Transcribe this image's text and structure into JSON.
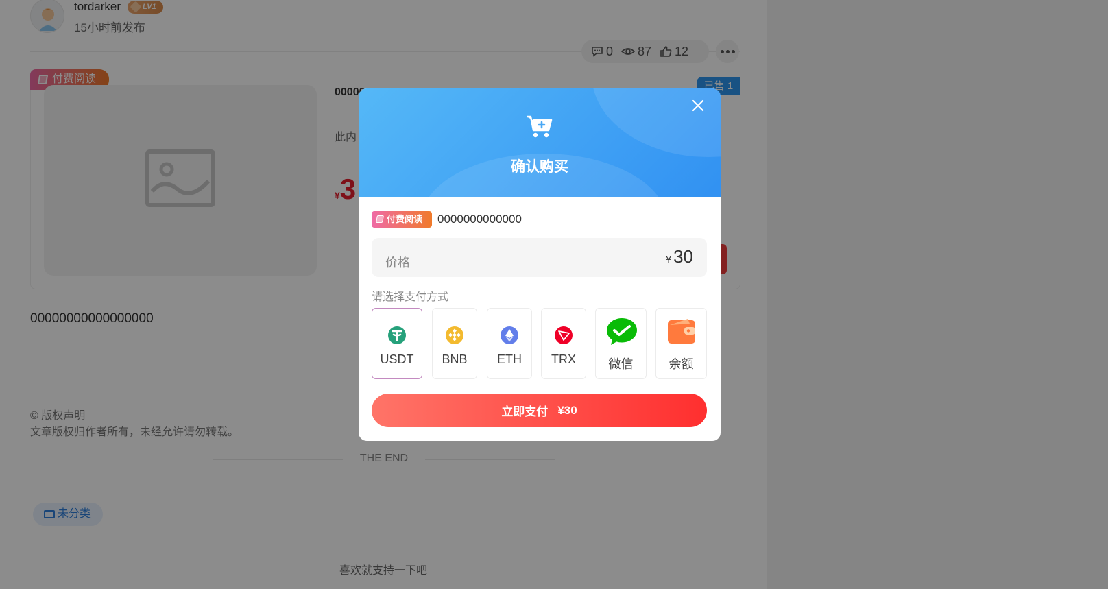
{
  "author": {
    "name": "tordarker",
    "level": "LV1",
    "post_time": "15小时前发布"
  },
  "stats": {
    "comments": "0",
    "views": "87",
    "likes": "12"
  },
  "card": {
    "tag": "付费阅读",
    "title": "0000000000000",
    "desc": "此内",
    "price_symbol": "¥",
    "price": "3",
    "sold": "已售 1"
  },
  "content": {
    "body": "00000000000000000",
    "copyright_title": "© 版权声明",
    "copyright_text": "文章版权归作者所有，未经允许请勿转载。",
    "end": "THE END",
    "category": "未分类",
    "support": "喜欢就支持一下吧"
  },
  "modal": {
    "title": "确认购买",
    "item_tag": "付费阅读",
    "item_name": "0000000000000",
    "price_label": "价格",
    "price_symbol": "¥",
    "price": "30",
    "choose_label": "请选择支付方式",
    "methods": [
      {
        "label": "USDT",
        "icon": "usdt-icon",
        "color": "#26a17b",
        "selected": true
      },
      {
        "label": "BNB",
        "icon": "bnb-icon",
        "color": "#f3ba2f",
        "selected": false
      },
      {
        "label": "ETH",
        "icon": "eth-icon",
        "color": "#627eea",
        "selected": false
      },
      {
        "label": "TRX",
        "icon": "trx-icon",
        "color": "#ef0027",
        "selected": false
      },
      {
        "label": "微信",
        "icon": "wechat-icon",
        "color": "#09bb07",
        "selected": false
      },
      {
        "label": "余额",
        "icon": "wallet-icon",
        "color": "#ff7a3d",
        "selected": false
      }
    ],
    "pay_label": "立即支付",
    "pay_amount": "¥30"
  },
  "colors": {
    "accent": "#3191f2",
    "pay": "#ff2f2f",
    "tag_start": "#ef6aa6",
    "tag_end": "#f07a2a"
  }
}
